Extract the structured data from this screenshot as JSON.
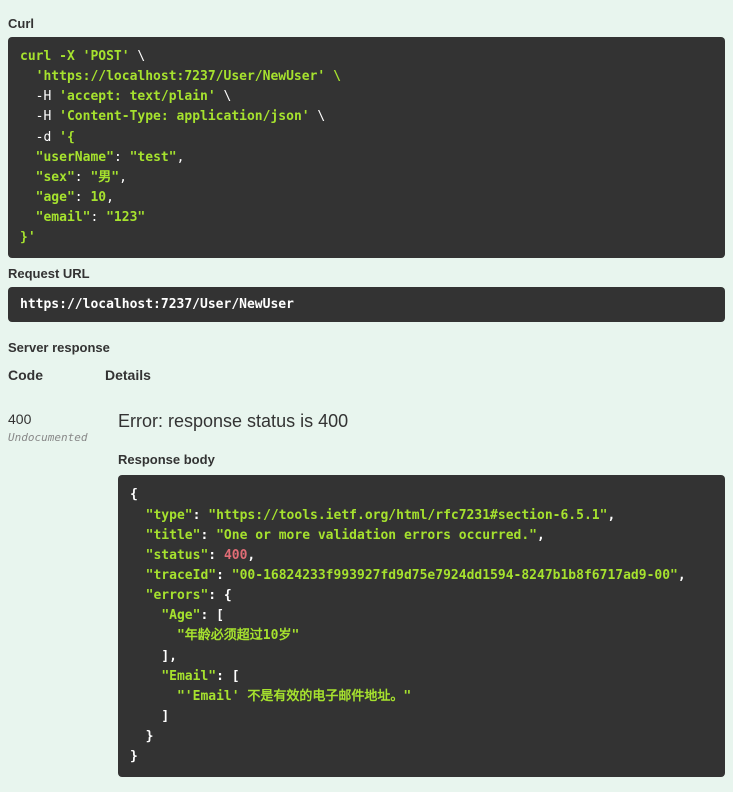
{
  "curl": {
    "label": "Curl",
    "line1_cmd": "curl -X ",
    "line1_method": "'POST'",
    "line1_end": " \\",
    "line2": "  'https://localhost:7237/User/NewUser' \\",
    "line3_pre": "  -H ",
    "line3_val": "'accept: text/plain'",
    "line3_end": " \\",
    "line4_pre": "  -H ",
    "line4_val": "'Content-Type: application/json'",
    "line4_end": " \\",
    "line5_pre": "  -d ",
    "line5_val": "'{",
    "line6_k": "\"userName\"",
    "line6_v": "\"test\"",
    "line7_k": "\"sex\"",
    "line7_v": "\"男\"",
    "line8_k": "\"age\"",
    "line8_v": "10",
    "line9_k": "\"email\"",
    "line9_v": "\"123\"",
    "line10": "}'"
  },
  "request_url": {
    "label": "Request URL",
    "value": "https://localhost:7237/User/NewUser"
  },
  "server": {
    "label": "Server response",
    "code_header": "Code",
    "details_header": "Details",
    "status": "400",
    "undocumented": "Undocumented",
    "error": "Error: response status is 400",
    "body_label": "Response body"
  },
  "json": {
    "type_k": "\"type\"",
    "type_v": "\"https://tools.ietf.org/html/rfc7231#section-6.5.1\"",
    "title_k": "\"title\"",
    "title_v": "\"One or more validation errors occurred.\"",
    "status_k": "\"status\"",
    "status_v": "400",
    "trace_k": "\"traceId\"",
    "trace_v": "\"00-16824233f993927fd9d75e7924dd1594-8247b1b8f6717ad9-00\"",
    "errors_k": "\"errors\"",
    "age_k": "\"Age\"",
    "age_v": "\"年龄必须超过10岁\"",
    "email_k": "\"Email\"",
    "email_v": "\"'Email' 不是有效的电子邮件地址。\""
  }
}
